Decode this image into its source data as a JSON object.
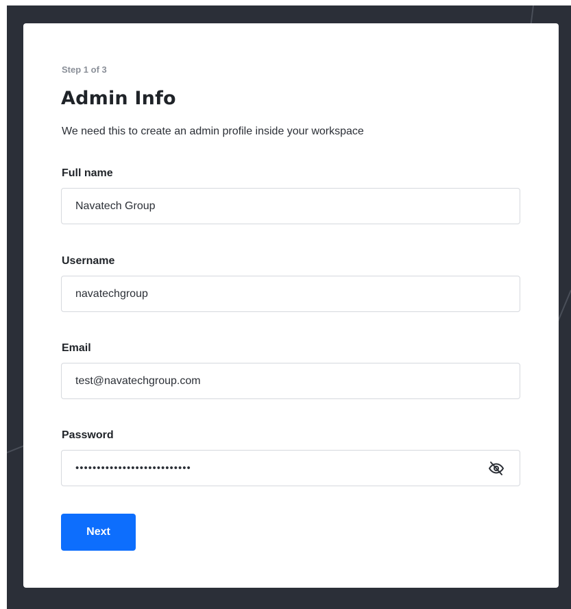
{
  "form": {
    "step": "Step 1 of 3",
    "title": "Admin Info",
    "subtitle": "We need this to create an admin profile inside your workspace",
    "fields": [
      {
        "label": "Full name",
        "value": "Navatech Group",
        "type": "text"
      },
      {
        "label": "Username",
        "value": "navatechgroup",
        "type": "text"
      },
      {
        "label": "Email",
        "value": "test@navatechgroup.com",
        "type": "email"
      },
      {
        "label": "Password",
        "value": "navatechgroup-password-1234",
        "type": "password"
      }
    ],
    "password_toggle_icon": "eye-off-icon",
    "next_label": "Next"
  },
  "theme": {
    "backdrop": "#2b2f38",
    "card": "#ffffff",
    "accent": "#0d6efd",
    "muted": "#8a8f98",
    "text": "#1f2328"
  }
}
